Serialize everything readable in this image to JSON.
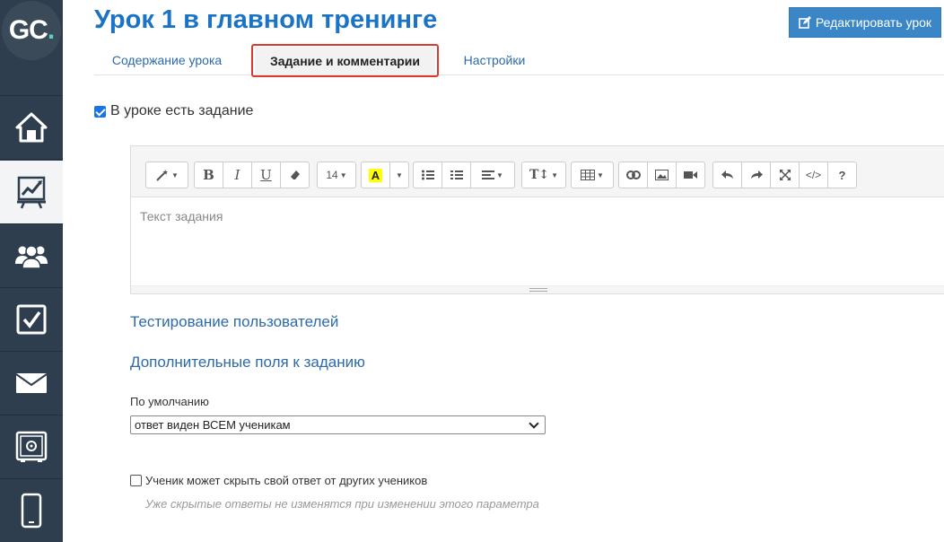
{
  "logo": {
    "text": "GC",
    "dot": "."
  },
  "header": {
    "title": "Урок 1 в главном тренинге",
    "edit_button": "Редактировать урок"
  },
  "tabs": [
    {
      "label": "Содержание урока"
    },
    {
      "label": "Задание и комментарии",
      "active": true
    },
    {
      "label": "Настройки"
    }
  ],
  "task": {
    "has_task_label": "В уроке есть задание",
    "has_task_checked": true
  },
  "editor": {
    "placeholder": "Текст задания",
    "font_size": "14",
    "toolbar": [
      "magic-wand",
      "bold",
      "italic",
      "underline",
      "eraser",
      "font-size",
      "text-color",
      "color-dropdown",
      "bullet-list",
      "numbered-list",
      "align",
      "line-height",
      "table",
      "link",
      "image",
      "video",
      "undo",
      "redo",
      "fullscreen",
      "code-view",
      "help"
    ],
    "bold": "B",
    "italic": "I",
    "underline": "U",
    "color": "A",
    "help": "?",
    "code": "</>",
    "height": "T↕"
  },
  "links": {
    "testing": "Тестирование пользователей",
    "extra_fields": "Дополнительные поля к заданию"
  },
  "visibility": {
    "label": "По умолчанию",
    "selected": "ответ виден ВСЕМ ученикам"
  },
  "hide_answer": {
    "label": "Ученик может скрыть свой ответ от других учеников",
    "checked": false,
    "hint": "Уже скрытые ответы не изменятся при изменении этого параметра"
  },
  "colors": {
    "sidebar": "#2e3e4e",
    "accent": "#1a73c5",
    "button": "#3a86c6",
    "highlight": "#d73a2f",
    "text_color_swatch": "#ffff00"
  }
}
